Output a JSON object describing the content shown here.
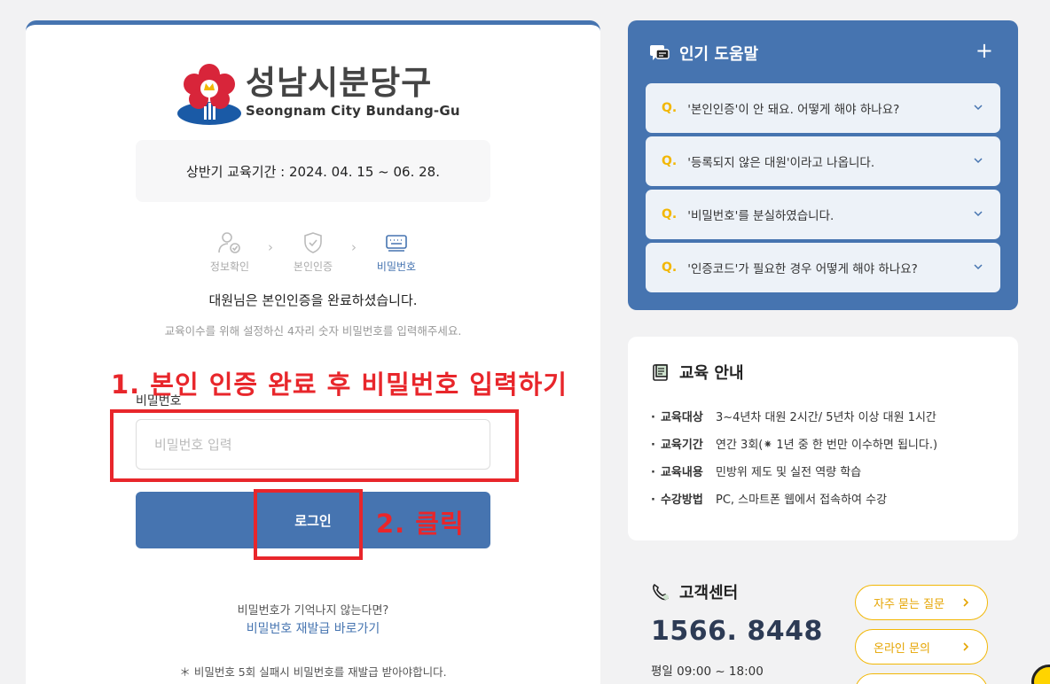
{
  "brand": {
    "name_ko": "성남시분당구",
    "name_en": "Seongnam City Bundang-Gu"
  },
  "login": {
    "period": "상반기 교육기간 : 2024. 04. 15 ~ 06. 28.",
    "steps": [
      {
        "label": "정보확인",
        "icon": "user-check-icon",
        "active": false
      },
      {
        "label": "본인인증",
        "icon": "shield-check-icon",
        "active": false
      },
      {
        "label": "비밀번호",
        "icon": "keyboard-icon",
        "active": true
      }
    ],
    "done_message": "대원님은 본인인증을 완료하셨습니다.",
    "hint": "교육이수를 위해 설정하신 4자리 숫자 비밀번호를 입력해주세요.",
    "password_label": "비밀번호",
    "password_placeholder": "비밀번호 입력",
    "password_value": "",
    "login_button": "로그인",
    "forgot_question": "비밀번호가 기억나지 않는다면?",
    "forgot_link": "비밀번호 재발급 바로가기",
    "warning": "＊ 비밀번호 5회 실패시 비밀번호를 재발급 받아야합니다."
  },
  "annotations": {
    "step1": "1. 본인 인증 완료 후 비밀번호 입력하기",
    "step2": "2. 클릭"
  },
  "help": {
    "title": "인기 도움말",
    "q_prefix": "Q.",
    "items": [
      "'본인인증'이 안 돼요. 어떻게 해야 하나요?",
      "'등록되지 않은 대원'이라고 나옵니다.",
      "'비밀번호'를 분실하였습니다.",
      "'인증코드'가 필요한 경우 어떻게 해야 하나요?"
    ]
  },
  "edu": {
    "title": "교육 안내",
    "rows": [
      {
        "key": "교육대상",
        "value": "3~4년차 대원 2시간/ 5년차 이상 대원 1시간"
      },
      {
        "key": "교육기간",
        "value": "연간 3회(⁕ 1년 중 한 번만 이수하면 됩니다.)"
      },
      {
        "key": "교육내용",
        "value": "민방위 제도 및 실전 역량 학습"
      },
      {
        "key": "수강방법",
        "value": "PC, 스마트폰 웹에서 접속하여 수강"
      }
    ]
  },
  "cs": {
    "title": "고객센터",
    "phone": "1566. 8448",
    "hours": "평일 09:00 ~ 18:00",
    "buttons": [
      "자주 묻는 질문",
      "온라인 문의"
    ]
  },
  "colors": {
    "primary": "#4674b0",
    "accent": "#f2b705",
    "annotation": "#e8262b"
  }
}
